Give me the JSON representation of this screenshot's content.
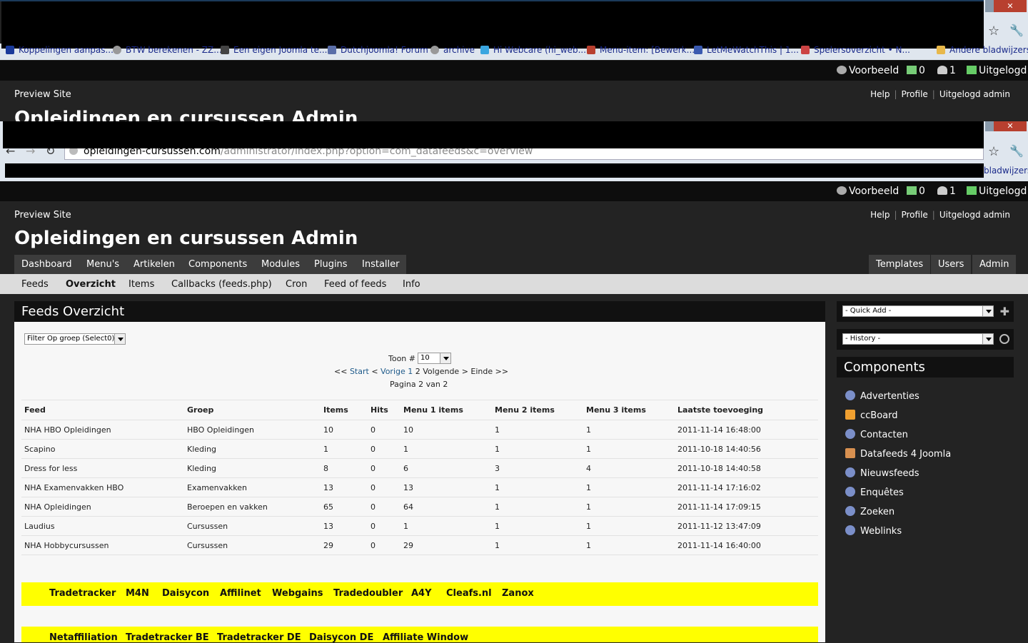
{
  "browser": {
    "bookmarks": [
      "Koppelingen aanpas...",
      "BTW berekenen - ZZ...",
      "Een eigen Joomla te...",
      "Dutchjoomla! Forum",
      "archive",
      "Hi Webcare (hi_web...",
      "Menu-item: [Bewerk...",
      "LetMeWatchThis | 1...",
      "Spelersoverzicht • N...",
      "Andere bladwijzers"
    ],
    "url_host": "opleidingen-cursussen.com",
    "url_path": "/administrator/index.php?option=com_datafeeds&c=overview",
    "other_bookmarks_partial": "bladwijzers",
    "close_label": "✕"
  },
  "status": {
    "preview": "Voorbeeld",
    "messages": "0",
    "users": "1",
    "logout": "Uitgelogd"
  },
  "header": {
    "preview_site": "Preview Site",
    "links": [
      "Help",
      "Profile",
      "Uitgelogd admin"
    ],
    "title": "Opleidingen en cursussen Admin"
  },
  "menu": {
    "left": [
      "Dashboard",
      "Menu's",
      "Artikelen",
      "Components",
      "Modules",
      "Plugins",
      "Installer"
    ],
    "right": [
      "Templates",
      "Users",
      "Admin"
    ]
  },
  "submenu": [
    "Feeds",
    "Overzicht",
    "Items",
    "Callbacks (feeds.php)",
    "Cron",
    "Feed of feeds",
    "Info"
  ],
  "panel": {
    "title": "Feeds Overzicht",
    "filter": "Filter Op groep (Select0)",
    "toon_label": "Toon #",
    "toon_value": "10",
    "pager": {
      "first_prefix": "<<",
      "start": "Start",
      "prev_prefix": "<",
      "prev": "Vorige",
      "page1": "1",
      "page2": "2",
      "next": "Volgende >",
      "end": "Einde >>"
    },
    "page_info": "Pagina 2 van 2"
  },
  "table": {
    "headers": [
      "Feed",
      "Groep",
      "Items",
      "Hits",
      "Menu 1 items",
      "Menu 2 items",
      "Menu 3 items",
      "Laatste toevoeging"
    ],
    "rows": [
      [
        "NHA HBO Opleidingen",
        "HBO Opleidingen",
        "10",
        "0",
        "10",
        "1",
        "1",
        "2011-11-14 16:48:00"
      ],
      [
        "Scapino",
        "Kleding",
        "1",
        "0",
        "1",
        "1",
        "1",
        "2011-10-18 14:40:56"
      ],
      [
        "Dress for less",
        "Kleding",
        "8",
        "0",
        "6",
        "3",
        "4",
        "2011-10-18 14:40:58"
      ],
      [
        "NHA Examenvakken HBO",
        "Examenvakken",
        "13",
        "0",
        "13",
        "1",
        "1",
        "2011-11-14 17:16:02"
      ],
      [
        "NHA Opleidingen",
        "Beroepen en vakken",
        "65",
        "0",
        "64",
        "1",
        "1",
        "2011-11-14 17:09:15"
      ],
      [
        "Laudius",
        "Cursussen",
        "13",
        "0",
        "1",
        "1",
        "1",
        "2011-11-12 13:47:09"
      ],
      [
        "NHA Hobbycursussen",
        "Cursussen",
        "29",
        "0",
        "29",
        "1",
        "1",
        "2011-11-14 16:40:00"
      ]
    ]
  },
  "networks_row1": [
    "Tradetracker",
    "M4N",
    "Daisycon",
    "Affilinet",
    "Webgains",
    "Tradedoubler",
    "A4Y",
    "Cleafs.nl",
    "Zanox"
  ],
  "networks_row2": [
    "Netaffiliation",
    "Tradetracker BE",
    "Tradetracker DE",
    "Daisycon DE",
    "Affiliate Window"
  ],
  "sidebar": {
    "quick_add": "- Quick Add -",
    "history": "- History -",
    "components_title": "Components",
    "components": [
      "Advertenties",
      "ccBoard",
      "Contacten",
      "Datafeeds 4 Joomla",
      "Nieuwsfeeds",
      "Enquêtes",
      "Zoeken",
      "Weblinks"
    ]
  }
}
